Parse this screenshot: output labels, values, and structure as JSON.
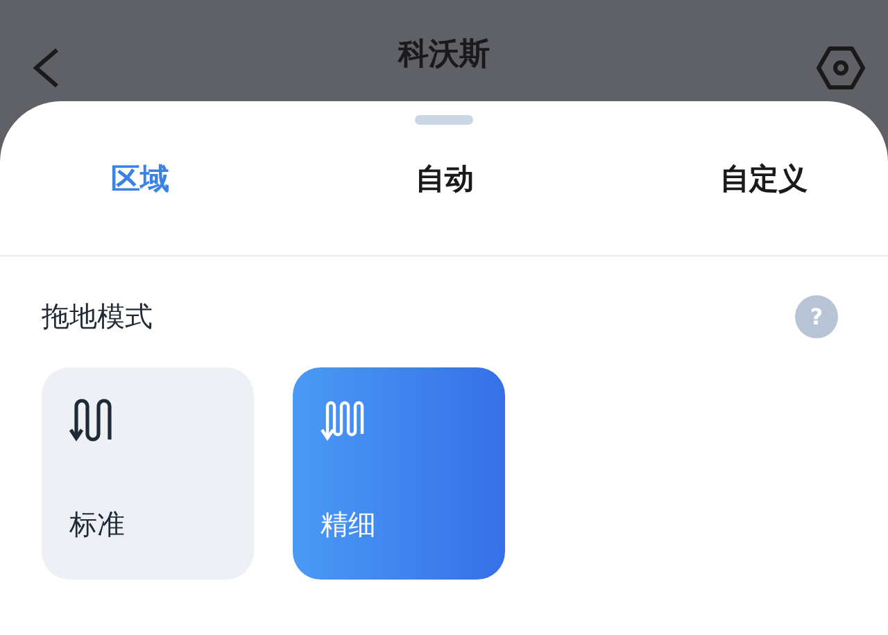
{
  "header": {
    "title": "科沃斯"
  },
  "tabs": [
    {
      "label": "区域",
      "selected": true
    },
    {
      "label": "自动",
      "selected": false
    },
    {
      "label": "自定义",
      "selected": false
    }
  ],
  "section": {
    "title": "拖地模式",
    "help": "?"
  },
  "modes": [
    {
      "label": "标准",
      "selected": false,
      "kind": "standard"
    },
    {
      "label": "精细",
      "selected": true,
      "kind": "fine"
    }
  ]
}
